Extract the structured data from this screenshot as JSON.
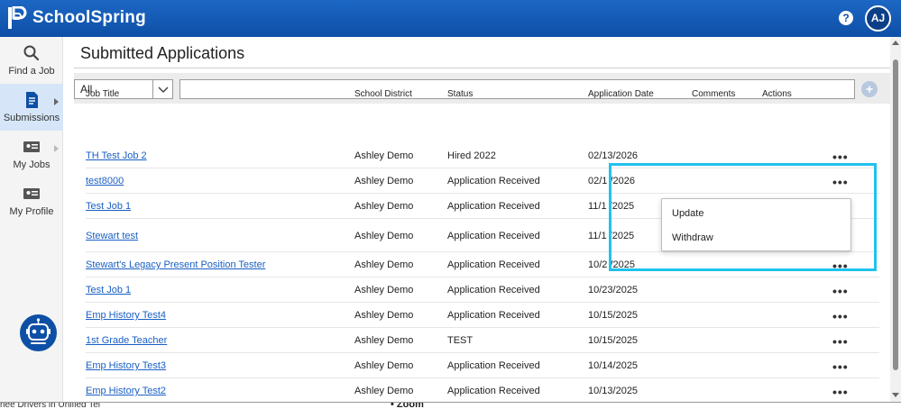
{
  "header": {
    "app_name": "SchoolSpring",
    "help_icon": "?",
    "avatar_initials": "AJ",
    "brand_color": "#0e4fa6"
  },
  "sidebar": {
    "items": [
      {
        "label": "Find a Job",
        "icon": "search-icon"
      },
      {
        "label": "Submissions",
        "icon": "document-icon",
        "active": true
      },
      {
        "label": "My Jobs",
        "icon": "id-card-icon"
      },
      {
        "label": "My Profile",
        "icon": "id-card-icon"
      }
    ],
    "bot_icon": "robot-icon"
  },
  "main": {
    "title": "Submitted Applications",
    "filter": {
      "selected": "All",
      "search_placeholder": ""
    },
    "columns": [
      "Job Title",
      "School District",
      "Status",
      "Application Date",
      "Comments",
      "Actions"
    ],
    "rows": [
      {
        "title": "TH Test Job 2",
        "district": "Ashley Demo",
        "status": "Hired 2022",
        "date": "02/13/2026"
      },
      {
        "title": "test8000",
        "district": "Ashley Demo",
        "status": "Application Received",
        "date": "02/1 /2026"
      },
      {
        "title": "Test Job 1",
        "district": "Ashley Demo",
        "status": "Application Received",
        "date": "11/1 /2025"
      },
      {
        "title": "Stewart test",
        "district": "Ashley Demo",
        "status": "Application Received",
        "date": "11/1 /2025"
      },
      {
        "title": "Stewart's Legacy Present Position Tester",
        "district": "Ashley Demo",
        "status": "Application Received",
        "date": "10/2 /2025"
      },
      {
        "title": "Test Job 1",
        "district": "Ashley Demo",
        "status": "Application Received",
        "date": "10/23/2025"
      },
      {
        "title": "Emp History Test4",
        "district": "Ashley Demo",
        "status": "Application Received",
        "date": "10/15/2025"
      },
      {
        "title": "1st Grade Teacher",
        "district": "Ashley Demo",
        "status": "TEST",
        "date": "10/15/2025"
      },
      {
        "title": "Emp History Test3",
        "district": "Ashley Demo",
        "status": "Application Received",
        "date": "10/14/2025"
      },
      {
        "title": "Emp History Test2",
        "district": "Ashley Demo",
        "status": "Application Received",
        "date": "10/13/2025"
      }
    ],
    "actions_icon": "•••",
    "context_menu": [
      "Update",
      "Withdraw"
    ],
    "highlight_color": "#1fc2ef"
  },
  "footer": {
    "left_text": "nee Drivers in Unified Tel",
    "zoom_text": "• Zoom"
  }
}
